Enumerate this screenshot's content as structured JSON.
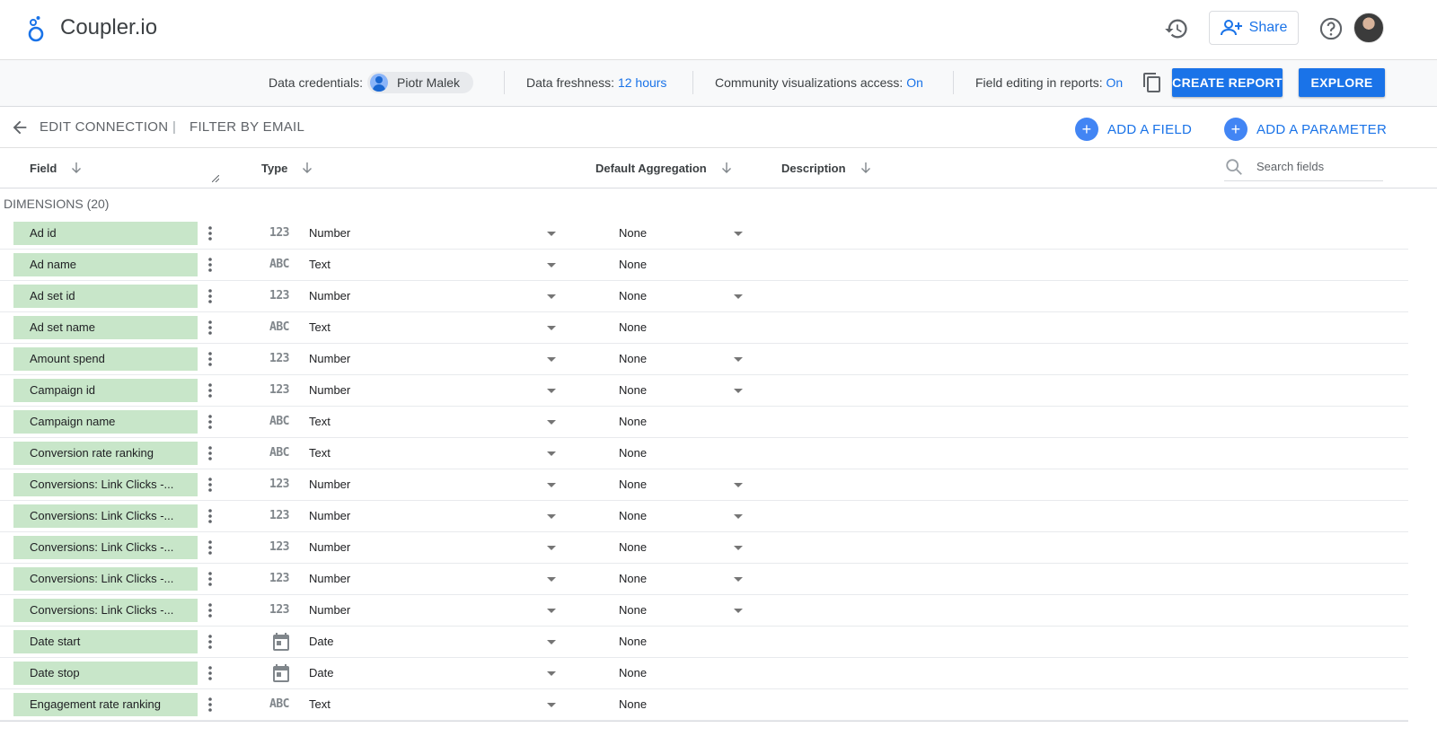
{
  "app": {
    "name": "Coupler.io"
  },
  "topbar": {
    "share_label": "Share"
  },
  "infobar": {
    "credentials_label": "Data credentials:",
    "credentials_user": "Piotr Malek",
    "freshness_label": "Data freshness:",
    "freshness_value": "12 hours",
    "community_label": "Community visualizations access:",
    "community_value": "On",
    "field_editing_label": "Field editing in reports:",
    "field_editing_value": "On",
    "create_report_label": "CREATE REPORT",
    "explore_label": "EXPLORE"
  },
  "nav": {
    "edit_connection": "EDIT CONNECTION",
    "separator": "|",
    "filter_by_email": "FILTER BY EMAIL",
    "add_field": "ADD A FIELD",
    "add_parameter": "ADD A PARAMETER"
  },
  "columns": {
    "field": "Field",
    "type": "Type",
    "default_aggregation": "Default Aggregation",
    "description": "Description",
    "search_placeholder": "Search fields"
  },
  "section_title": "DIMENSIONS (20)",
  "rows": [
    {
      "field": "Ad id",
      "type_icon": "123",
      "type": "Number",
      "aggregation": "None",
      "agg_dropdown": true
    },
    {
      "field": "Ad name",
      "type_icon": "ABC",
      "type": "Text",
      "aggregation": "None",
      "agg_dropdown": false
    },
    {
      "field": "Ad set id",
      "type_icon": "123",
      "type": "Number",
      "aggregation": "None",
      "agg_dropdown": true
    },
    {
      "field": "Ad set name",
      "type_icon": "ABC",
      "type": "Text",
      "aggregation": "None",
      "agg_dropdown": false
    },
    {
      "field": "Amount spend",
      "type_icon": "123",
      "type": "Number",
      "aggregation": "None",
      "agg_dropdown": true
    },
    {
      "field": "Campaign id",
      "type_icon": "123",
      "type": "Number",
      "aggregation": "None",
      "agg_dropdown": true
    },
    {
      "field": "Campaign name",
      "type_icon": "ABC",
      "type": "Text",
      "aggregation": "None",
      "agg_dropdown": false
    },
    {
      "field": "Conversion rate ranking",
      "type_icon": "ABC",
      "type": "Text",
      "aggregation": "None",
      "agg_dropdown": false
    },
    {
      "field": "Conversions: Link Clicks -...",
      "type_icon": "123",
      "type": "Number",
      "aggregation": "None",
      "agg_dropdown": true
    },
    {
      "field": "Conversions: Link Clicks -...",
      "type_icon": "123",
      "type": "Number",
      "aggregation": "None",
      "agg_dropdown": true
    },
    {
      "field": "Conversions: Link Clicks -...",
      "type_icon": "123",
      "type": "Number",
      "aggregation": "None",
      "agg_dropdown": true
    },
    {
      "field": "Conversions: Link Clicks -...",
      "type_icon": "123",
      "type": "Number",
      "aggregation": "None",
      "agg_dropdown": true
    },
    {
      "field": "Conversions: Link Clicks -...",
      "type_icon": "123",
      "type": "Number",
      "aggregation": "None",
      "agg_dropdown": true
    },
    {
      "field": "Date start",
      "type_icon": "calendar",
      "type": "Date",
      "aggregation": "None",
      "agg_dropdown": false
    },
    {
      "field": "Date stop",
      "type_icon": "calendar",
      "type": "Date",
      "aggregation": "None",
      "agg_dropdown": false
    },
    {
      "field": "Engagement rate ranking",
      "type_icon": "ABC",
      "type": "Text",
      "aggregation": "None",
      "agg_dropdown": false
    }
  ]
}
